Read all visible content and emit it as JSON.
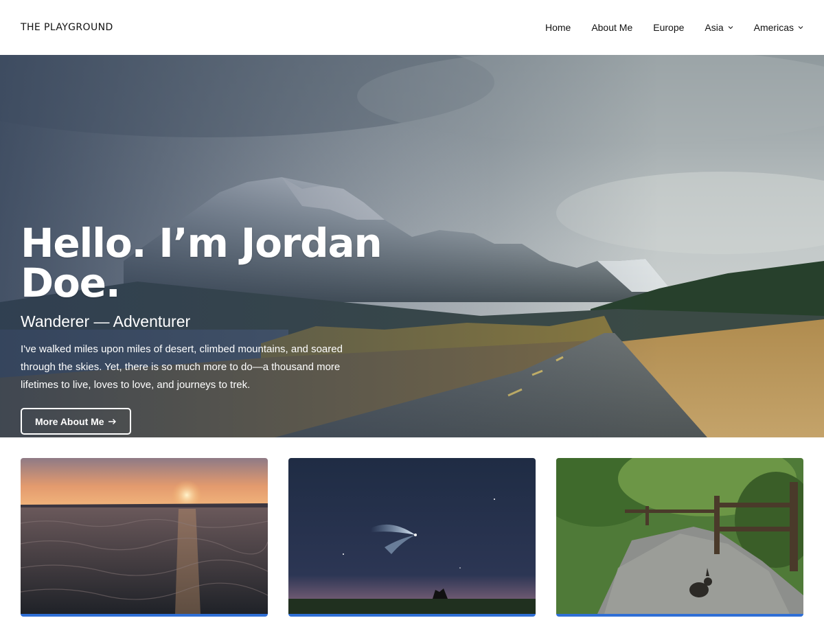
{
  "header": {
    "site_title": "THE PLAYGROUND",
    "nav": [
      {
        "label": "Home",
        "has_dropdown": false
      },
      {
        "label": "About Me",
        "has_dropdown": false
      },
      {
        "label": "Europe",
        "has_dropdown": false
      },
      {
        "label": "Asia",
        "has_dropdown": true
      },
      {
        "label": "Americas",
        "has_dropdown": true
      }
    ]
  },
  "hero": {
    "title": "Hello. I’m Jordan Doe.",
    "subtitle": "Wanderer — Adventurer",
    "body": "I've walked miles upon miles of desert, climbed mountains, and soared through the skies. Yet, there is so much more to do—a thousand more lifetimes to live, loves to love, and journeys to trek.",
    "button_label": "More About Me",
    "button_icon": "arrow-right-icon"
  },
  "cards": [
    {
      "image": "sunset-over-water-image"
    },
    {
      "image": "night-sky-rocket-image"
    },
    {
      "image": "forest-path-rabbit-image"
    }
  ],
  "colors": {
    "accent": "#2f6fd6",
    "header_bg": "#ffffff",
    "text": "#111111"
  }
}
